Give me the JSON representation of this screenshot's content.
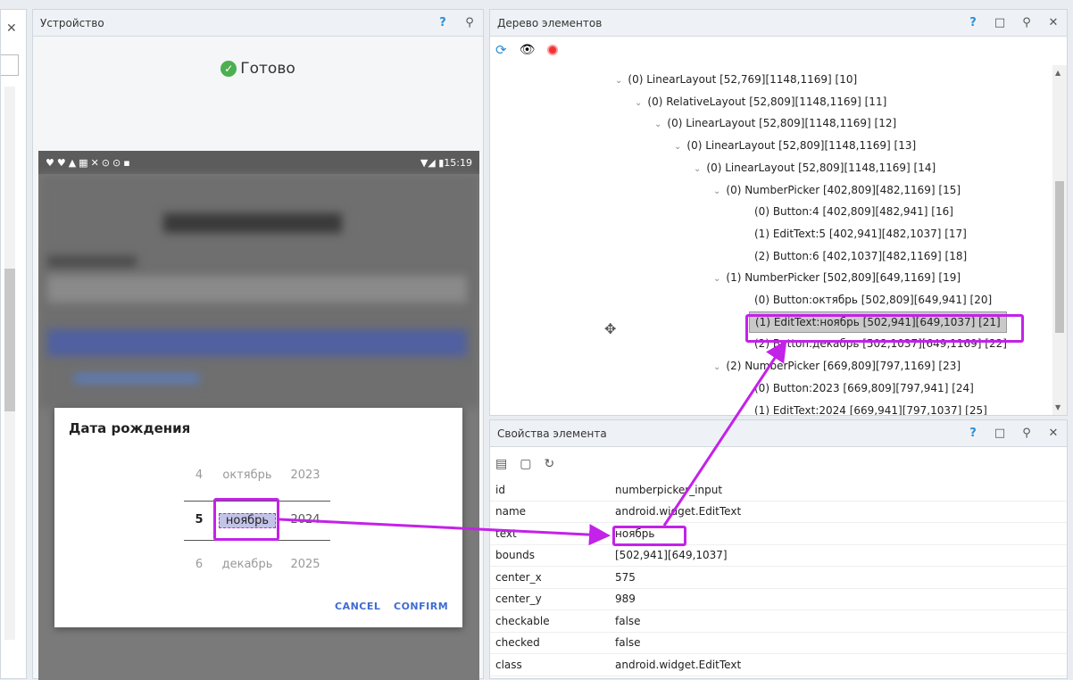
{
  "device_panel": {
    "title": "Устройство",
    "help": "?",
    "pin": "⊓",
    "status": "Готово"
  },
  "phone": {
    "status_time": "15:19",
    "dialog": {
      "title": "Дата рождения",
      "days": [
        "4",
        "5",
        "6"
      ],
      "months": [
        "октябрь",
        "ноябрь",
        "декабрь"
      ],
      "years": [
        "2023",
        "2024",
        "2025"
      ],
      "cancel": "CANCEL",
      "confirm": "CONFIRM"
    }
  },
  "tree_panel": {
    "title": "Дерево элементов",
    "help": "?",
    "nodes": [
      "(0) LinearLayout [52,769][1148,1169] [10]",
      "(0) RelativeLayout [52,809][1148,1169] [11]",
      "(0) LinearLayout [52,809][1148,1169] [12]",
      "(0) LinearLayout [52,809][1148,1169] [13]",
      "(0) LinearLayout [52,809][1148,1169] [14]",
      "(0) NumberPicker [402,809][482,1169] [15]",
      "(0) Button:4 [402,809][482,941] [16]",
      "(1) EditText:5 [402,941][482,1037] [17]",
      "(2) Button:6 [402,1037][482,1169] [18]",
      "(1) NumberPicker [502,809][649,1169] [19]",
      "(0) Button:октябрь [502,809][649,941] [20]",
      "(1) EditText:ноябрь [502,941][649,1037] [21]",
      "(2) Button:декабрь [502,1037][649,1169] [22]",
      "(2) NumberPicker [669,809][797,1169] [23]",
      "(0) Button:2023 [669,809][797,941] [24]",
      "(1) EditText:2024 [669,941][797,1037] [25]"
    ]
  },
  "props_panel": {
    "title": "Свойства элемента",
    "help": "?",
    "rows": [
      {
        "k": "id",
        "v": "numberpicker_input"
      },
      {
        "k": "name",
        "v": "android.widget.EditText"
      },
      {
        "k": "text",
        "v": "ноябрь"
      },
      {
        "k": "bounds",
        "v": "[502,941][649,1037]"
      },
      {
        "k": "center_x",
        "v": "575"
      },
      {
        "k": "center_y",
        "v": "989"
      },
      {
        "k": "checkable",
        "v": "false"
      },
      {
        "k": "checked",
        "v": "false"
      },
      {
        "k": "class",
        "v": "android.widget.EditText"
      }
    ]
  },
  "colors": {
    "highlight": "#c322e8",
    "accent": "#3f6bd1"
  }
}
